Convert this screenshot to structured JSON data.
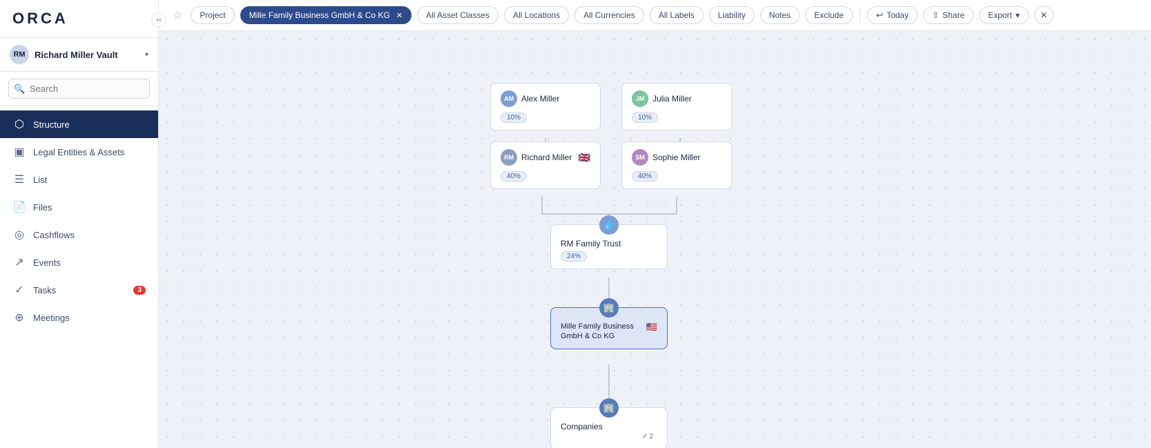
{
  "sidebar": {
    "logo": "ORCA",
    "vault": {
      "name": "Richard Miller Vault",
      "chevron": "▾"
    },
    "search_placeholder": "Search",
    "items": [
      {
        "id": "structure",
        "label": "Structure",
        "icon": "⬡",
        "active": true,
        "badge": null
      },
      {
        "id": "legal-entities",
        "label": "Legal Entities & Assets",
        "icon": "▢",
        "active": false,
        "badge": null
      },
      {
        "id": "list",
        "label": "List",
        "icon": "≡",
        "active": false,
        "badge": null
      },
      {
        "id": "files",
        "label": "Files",
        "icon": "📄",
        "active": false,
        "badge": null
      },
      {
        "id": "cashflows",
        "label": "Cashflows",
        "icon": "⊙",
        "active": false,
        "badge": null
      },
      {
        "id": "events",
        "label": "Events",
        "icon": "↗",
        "active": false,
        "badge": null
      },
      {
        "id": "tasks",
        "label": "Tasks",
        "icon": "✓",
        "active": false,
        "badge": "3"
      },
      {
        "id": "meetings",
        "label": "Meetings",
        "icon": "⊕",
        "active": false,
        "badge": null
      }
    ]
  },
  "toolbar": {
    "star_label": "★",
    "buttons": [
      {
        "id": "project",
        "label": "Project",
        "active": false
      },
      {
        "id": "selected-entity",
        "label": "Mille Family Business GmbH & Co KG",
        "active": true,
        "selected": true
      },
      {
        "id": "all-asset-classes",
        "label": "All Asset Classes",
        "active": false
      },
      {
        "id": "all-locations",
        "label": "All Locations",
        "active": false
      },
      {
        "id": "all-currencies",
        "label": "All Currencies",
        "active": false
      },
      {
        "id": "all-labels",
        "label": "All Labels",
        "active": false
      },
      {
        "id": "liability",
        "label": "Liability",
        "active": false
      },
      {
        "id": "notes",
        "label": "Notes",
        "active": false
      },
      {
        "id": "exclude",
        "label": "Exclude",
        "active": false
      },
      {
        "id": "today",
        "label": "Today",
        "active": false,
        "icon": "↩"
      },
      {
        "id": "share",
        "label": "Share",
        "active": false,
        "icon": "⇧"
      },
      {
        "id": "export",
        "label": "Export",
        "active": false,
        "icon": "▾"
      }
    ]
  },
  "chart": {
    "nodes": [
      {
        "id": "alex-miller",
        "name": "Alex Miller",
        "initials": "AM",
        "color": "#7b9ed4",
        "percent": "10%",
        "flag": null
      },
      {
        "id": "julia-miller",
        "name": "Julia Miller",
        "initials": "JM",
        "color": "#7bc4a0",
        "percent": "10%",
        "flag": null
      },
      {
        "id": "richard-miller",
        "name": "Richard Miller",
        "initials": "RM",
        "color": "#8a9fc0",
        "percent": "40%",
        "flag": "🇬🇧"
      },
      {
        "id": "sophie-miller",
        "name": "Sophie Miller",
        "initials": "SM",
        "color": "#b08abf",
        "percent": "40%",
        "flag": null
      },
      {
        "id": "rm-family-trust",
        "name": "RM Family Trust",
        "icon": "💧",
        "icon_bg": "#7b9ed4",
        "percent": "24%",
        "type": "trust"
      },
      {
        "id": "mille-family-business",
        "name": "Mille Family Business GmbH & Co KG",
        "icon": "🏢",
        "icon_bg": "#5a7abf",
        "percent": null,
        "flag": "🇺🇸",
        "type": "company",
        "selected": true
      },
      {
        "id": "companies",
        "name": "Companies",
        "icon": "🏢",
        "icon_bg": "#5a7abf",
        "type": "company",
        "expand": "2"
      }
    ]
  }
}
